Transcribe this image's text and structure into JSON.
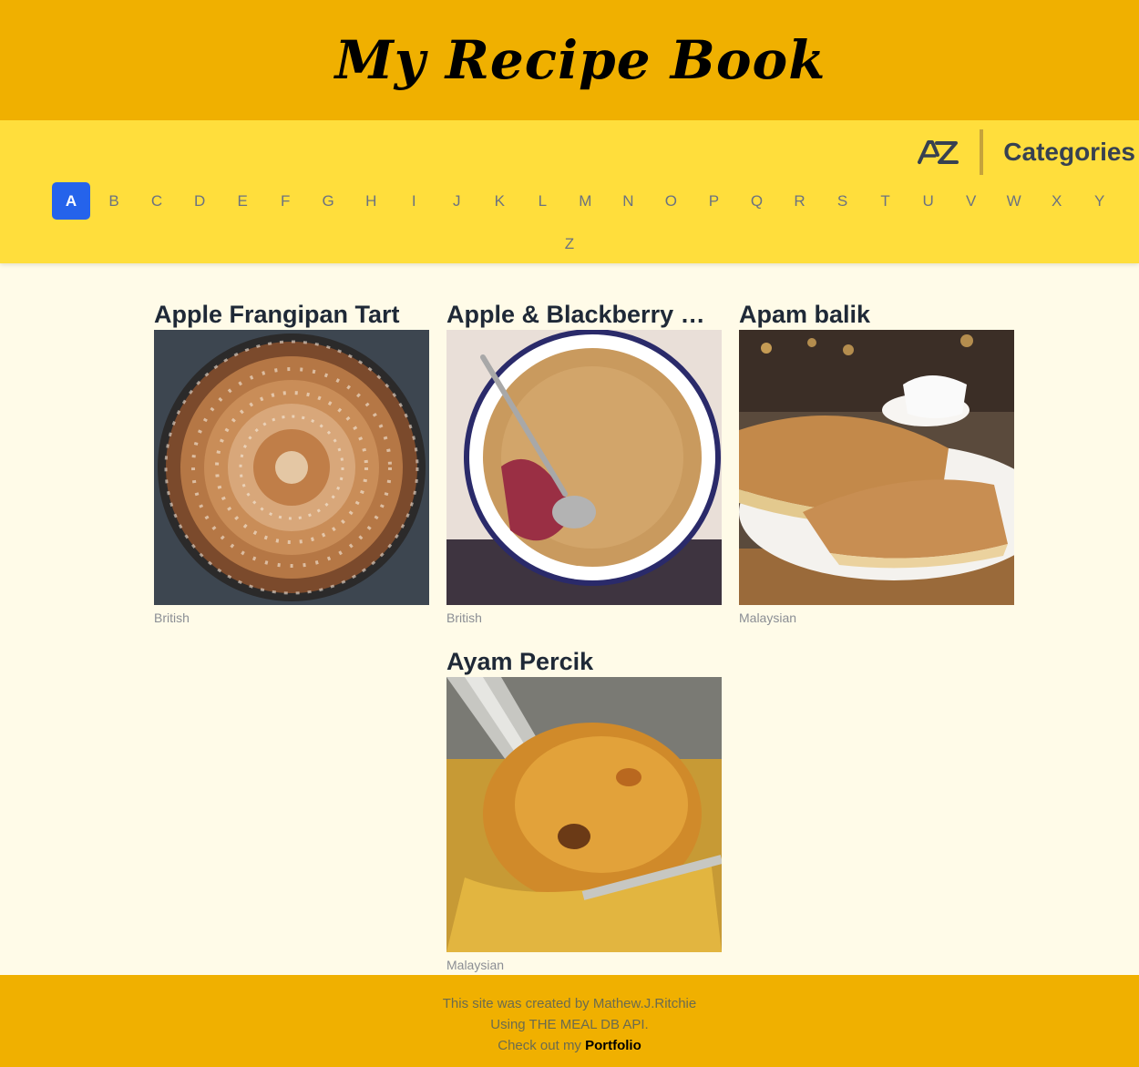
{
  "header": {
    "title": "My Recipe Book"
  },
  "nav": {
    "az_icon": "az-sort-icon",
    "categories_label": "Categories",
    "letters": [
      "A",
      "B",
      "C",
      "D",
      "E",
      "F",
      "G",
      "H",
      "I",
      "J",
      "K",
      "L",
      "M",
      "N",
      "O",
      "P",
      "Q",
      "R",
      "S",
      "T",
      "U",
      "V",
      "W",
      "X",
      "Y",
      "Z"
    ],
    "active_letter": "A"
  },
  "meals": [
    {
      "title": "Apple Frangipan Tart",
      "area": "British"
    },
    {
      "title": "Apple & Blackberry Crumble",
      "area": "British"
    },
    {
      "title": "Apam balik",
      "area": "Malaysian"
    },
    {
      "title": "Ayam Percik",
      "area": "Malaysian"
    }
  ],
  "footer": {
    "line1": "This site was created by Mathew.J.Ritchie",
    "line2": "Using THE MEAL DB API.",
    "line3_prefix": "Check out my",
    "portfolio_label": "Portfolio"
  },
  "colors": {
    "header_bg": "#f0b000",
    "nav_bg": "#ffde3c",
    "page_bg": "#fffbe8",
    "active_letter_bg": "#2563eb"
  }
}
